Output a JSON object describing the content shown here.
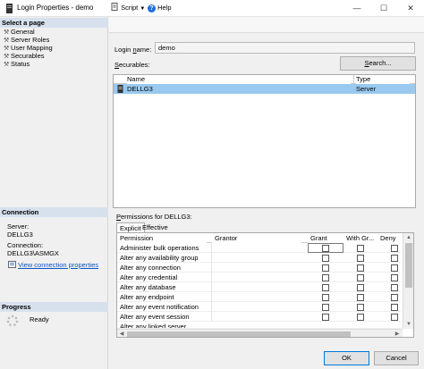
{
  "window": {
    "title": "Login Properties - demo",
    "minimize": "—",
    "maximize": "☐",
    "close": "✕"
  },
  "left": {
    "select_page_header": "Select a page",
    "pages": [
      "General",
      "Server Roles",
      "User Mapping",
      "Securables",
      "Status"
    ],
    "connection_header": "Connection",
    "server_label": "Server:",
    "server_value": "DELLG3",
    "connection_label": "Connection:",
    "connection_value": "DELLG3\\ASMGX",
    "view_connection_link": "View connection properties",
    "progress_header": "Progress",
    "progress_status": "Ready"
  },
  "toolbar": {
    "script_label": "Script",
    "help_label": "Help"
  },
  "form": {
    "login_name_label_u": "n",
    "login_name_label_pre": "Login ",
    "login_name_label_post": "ame:",
    "login_name_value": "demo",
    "securables_label_pre": "S",
    "securables_label_post": "ecurables:",
    "search_button_pre": "S",
    "search_button_post": "earch..."
  },
  "securables_grid": {
    "columns": [
      "Name",
      "Type"
    ],
    "rows": [
      {
        "name": "DELLG3",
        "type": "Server"
      }
    ]
  },
  "permissions": {
    "label_pre": "P",
    "label_post": "ermissions for DELLG3:",
    "tabs": [
      "Explicit",
      "Effective"
    ],
    "columns": [
      "Permission",
      "Grantor",
      "Grant",
      "With Gr...",
      "Deny"
    ],
    "rows": [
      "Administer bulk operations",
      "Alter any availability group",
      "Alter any connection",
      "Alter any credential",
      "Alter any database",
      "Alter any endpoint",
      "Alter any event notification",
      "Alter any event session",
      "Alter any linked server"
    ]
  },
  "footer": {
    "ok_label": "OK",
    "cancel_label": "Cancel"
  }
}
